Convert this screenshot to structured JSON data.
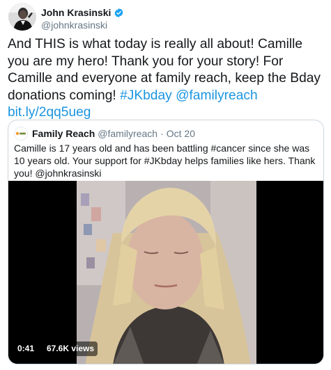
{
  "author": {
    "display_name": "John Krasinski",
    "handle": "@johnkrasinski",
    "verified_icon": "verified-badge-icon",
    "verified_color": "#1da1f2"
  },
  "tweet": {
    "text_parts": [
      {
        "text": "And THIS is what today is really all about!  Camille you are my hero!  Thank you for your story!  For Camille and everyone at family reach, keep the Bday donations coming! ",
        "type": "text"
      },
      {
        "text": "#JKbday",
        "type": "hashtag"
      },
      {
        "text": " ",
        "type": "text"
      },
      {
        "text": "@familyreach",
        "type": "mention"
      },
      {
        "text": " ",
        "type": "text"
      },
      {
        "text": "bit.ly/2qq5ueg",
        "type": "url"
      }
    ],
    "link_color": "#1b95e0"
  },
  "quoted": {
    "display_name": "Family Reach",
    "handle": "@familyreach",
    "separator": "·",
    "date": "Oct 20",
    "text": "Camille is 17 years old and has been battling #cancer since she was 10 years old. Your support for #JKbday helps families like hers. Thank you! @johnkrasinski",
    "video": {
      "duration": "0:41",
      "views": "67.6K views"
    }
  }
}
